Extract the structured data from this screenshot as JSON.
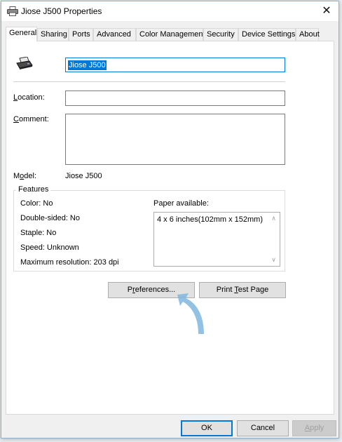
{
  "window": {
    "title": "Jiose J500 Properties",
    "close_glyph": "✕"
  },
  "tabs": [
    {
      "label": "General",
      "active": true
    },
    {
      "label": "Sharing"
    },
    {
      "label": "Ports"
    },
    {
      "label": "Advanced"
    },
    {
      "label": "Color Management"
    },
    {
      "label": "Security"
    },
    {
      "label": "Device Settings"
    },
    {
      "label": "About"
    }
  ],
  "general": {
    "printer_name": "Jiose J500",
    "location_label": "Location:",
    "location_mnemonic": "L",
    "location_rest": "ocation:",
    "location_value": "",
    "comment_label": "Comment:",
    "comment_mnemonic": "C",
    "comment_rest": "omment:",
    "comment_value": "",
    "model_label_pre": "M",
    "model_label_mnemonic": "o",
    "model_label_post": "del:",
    "model_value": "Jiose J500"
  },
  "features": {
    "title": "Features",
    "color": "Color: No",
    "double_sided": "Double-sided: No",
    "staple": "Staple: No",
    "speed": "Speed: Unknown",
    "max_resolution": "Maximum resolution: 203 dpi",
    "paper_label": "Paper available:",
    "paper_items": [
      "4 x 6 inches(102mm x 152mm)"
    ]
  },
  "buttons": {
    "preferences_pre": "P",
    "preferences_mnemonic": "r",
    "preferences_post": "eferences...",
    "print_test_pre": "Print ",
    "print_test_mnemonic": "T",
    "print_test_post": "est Page",
    "ok": "OK",
    "cancel": "Cancel",
    "apply_mnemonic": "A",
    "apply_rest": "pply"
  },
  "colors": {
    "accent": "#0078d7",
    "annotation_arrow": "#7fb6de"
  }
}
